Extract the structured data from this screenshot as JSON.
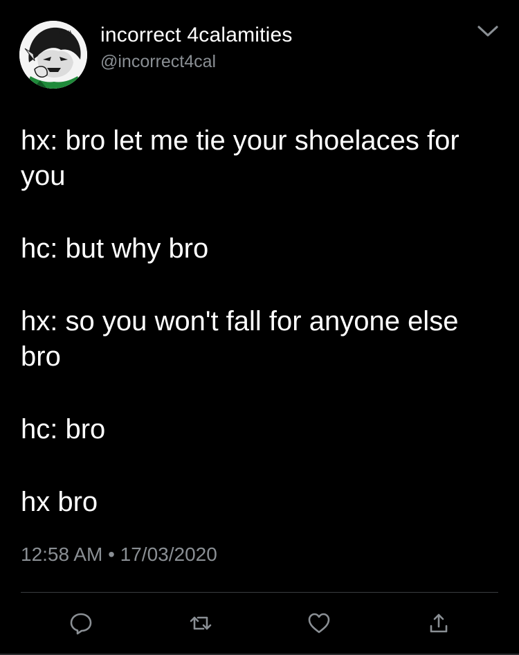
{
  "tweet": {
    "author": {
      "display_name": "incorrect 4calamities",
      "handle": "@incorrect4cal",
      "avatar_icon": "avatar-illustration"
    },
    "menu_icon": "chevron-down-icon",
    "lines": [
      "hx: bro let me tie your shoelaces for you",
      "hc: but why bro",
      "hx: so you won't fall for anyone else bro",
      "hc: bro",
      "hx bro"
    ],
    "timestamp": "12:58 AM • 17/03/2020",
    "actions": [
      {
        "icon": "reply-icon"
      },
      {
        "icon": "retweet-icon"
      },
      {
        "icon": "like-icon"
      },
      {
        "icon": "share-icon"
      }
    ],
    "colors": {
      "background": "#000000",
      "text": "#ffffff",
      "secondary": "#8a8f94",
      "divider": "#3a3d40"
    }
  }
}
